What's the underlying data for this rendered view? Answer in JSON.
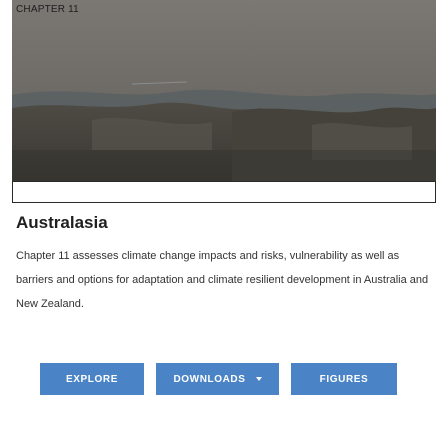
{
  "chapter": {
    "label": "CHAPTER 11",
    "title": "Australasia",
    "description": "Chapter 11 assesses climate change impacts and risks, vulnerability as well as barriers and options for adaptation and climate resilient development in Australia and New Zealand.",
    "image": "coastal-rock-landscape-photo"
  },
  "buttons": {
    "explore": "EXPLORE",
    "downloads": "DOWNLOADS",
    "downloads_icon": "caret-down-icon",
    "figures": "FIGURES"
  },
  "colors": {
    "button": "#4a84c6",
    "button_text": "#ffffff",
    "title": "#1f1f1f",
    "body_text": "#333333"
  }
}
